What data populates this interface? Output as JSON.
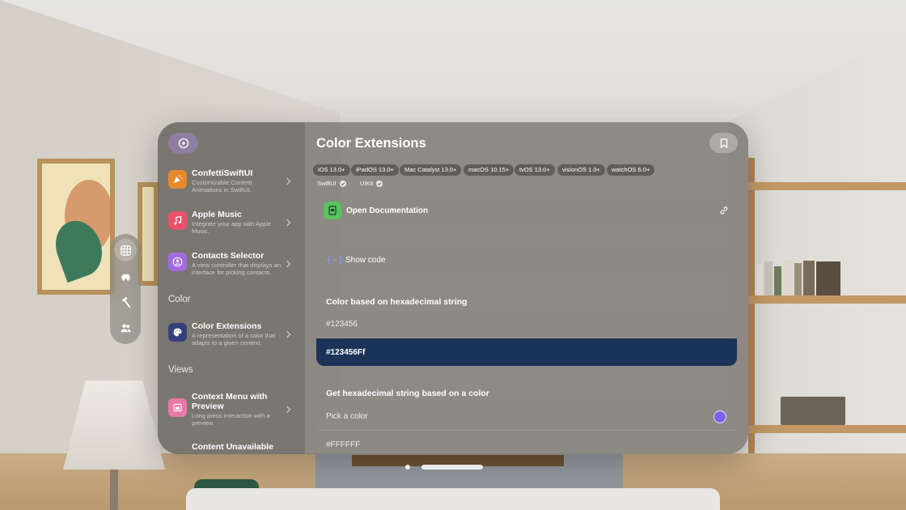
{
  "sidebar": {
    "items": [
      {
        "title": "ConfettiSwiftUI",
        "subtitle": "Customizable Confetti Animations in SwiftUI.",
        "icon": "party-popper-icon",
        "color": "#e58a2b"
      },
      {
        "title": "Apple Music",
        "subtitle": "Integrate your app with Apple Music.",
        "icon": "music-note-icon",
        "color": "#e9506a"
      },
      {
        "title": "Contacts Selector",
        "subtitle": "A view controller that displays an interface for picking contacts.",
        "icon": "person-icon",
        "color": "#a46be0"
      }
    ],
    "section_color": "Color",
    "color_items": [
      {
        "title": "Color Extensions",
        "subtitle": "A representation of a color that adapts to a given context.",
        "icon": "palette-icon",
        "color": "#34407a"
      }
    ],
    "section_views": "Views",
    "views_items": [
      {
        "title": "Context Menu with Preview",
        "subtitle": "Long press interaction with a preview.",
        "icon": "preview-icon",
        "color": "#e77aa9"
      },
      {
        "title": "Content Unavailable",
        "subtitle": "",
        "icon": "",
        "color": ""
      }
    ]
  },
  "content": {
    "title": "Color Extensions",
    "platforms": [
      "iOS 13.0+",
      "iPadOS 13.0+",
      "Mac Catalyst 13.0+",
      "macOS 10.15+",
      "tvOS 13.0+",
      "visionOS 1.0+",
      "watchOS 6.0+"
    ],
    "frameworks": [
      "SwiftUI",
      "UIKit"
    ],
    "open_documentation": "Open Documentation",
    "show_code": "Show code",
    "code_glyph": "{-}",
    "section_hex_to_color": "Color based on hexadecimal string",
    "hex_input": "#123456",
    "hex_result": "#123456Ff",
    "section_color_to_hex": "Get hexadecimal string based on a color",
    "pick_color_label": "Pick a color",
    "picked_color": "#7b63f0",
    "color_result": "#FFFFFF"
  },
  "colors": {
    "accent": "#8f8ff5",
    "selected_row": "#1c3358",
    "documentation_icon": "#58c35f"
  }
}
